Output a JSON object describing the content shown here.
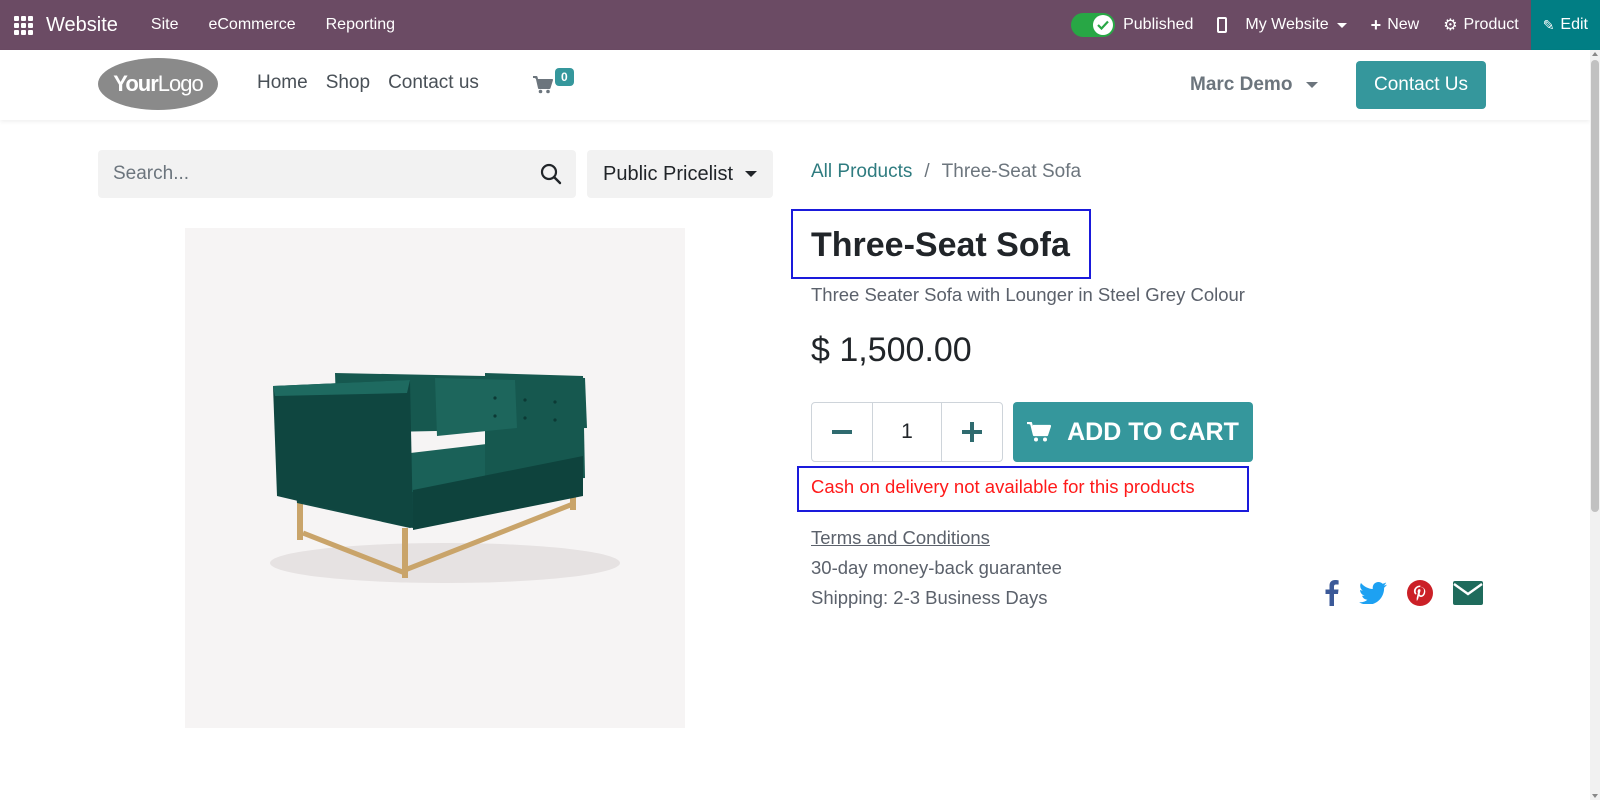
{
  "adminbar": {
    "brand": "Website",
    "menus": [
      "Site",
      "eCommerce",
      "Reporting"
    ],
    "published_label": "Published",
    "website_label": "My Website",
    "new_label": "New",
    "product_label": "Product",
    "edit_label": "Edit",
    "color": "#6b4b64"
  },
  "header": {
    "logo_bold": "Your",
    "logo_thin": "Logo",
    "nav": [
      "Home",
      "Shop",
      "Contact us"
    ],
    "cart_count": "0",
    "user": "Marc Demo",
    "contact_button": "Contact Us"
  },
  "search": {
    "placeholder": "Search..."
  },
  "pricelist": {
    "label": "Public Pricelist"
  },
  "breadcrumb": {
    "all_products": "All Products",
    "separator": "/",
    "current": "Three-Seat Sofa"
  },
  "product": {
    "name": "Three-Seat Sofa",
    "description": "Three Seater Sofa with Lounger in Steel Grey Colour",
    "price": "$ 1,500.00",
    "quantity": "1",
    "minus": "−",
    "plus": "+",
    "add_to_cart": "ADD TO CART",
    "cod_notice": "Cash on delivery not available for this products",
    "terms": "Terms and Conditions",
    "guarantee": "30-day money-back guarantee",
    "shipping": "Shipping: 2-3 Business Days",
    "image_icon": "green-sofa-image"
  },
  "share_icons": [
    "facebook-icon",
    "twitter-icon",
    "pinterest-icon",
    "email-icon"
  ],
  "colors": {
    "primary": "#35979c",
    "highlight_border": "#1a1adb",
    "notice_red": "#ff1a1a",
    "edit_button": "#017e84",
    "sofa": "#14504a"
  }
}
